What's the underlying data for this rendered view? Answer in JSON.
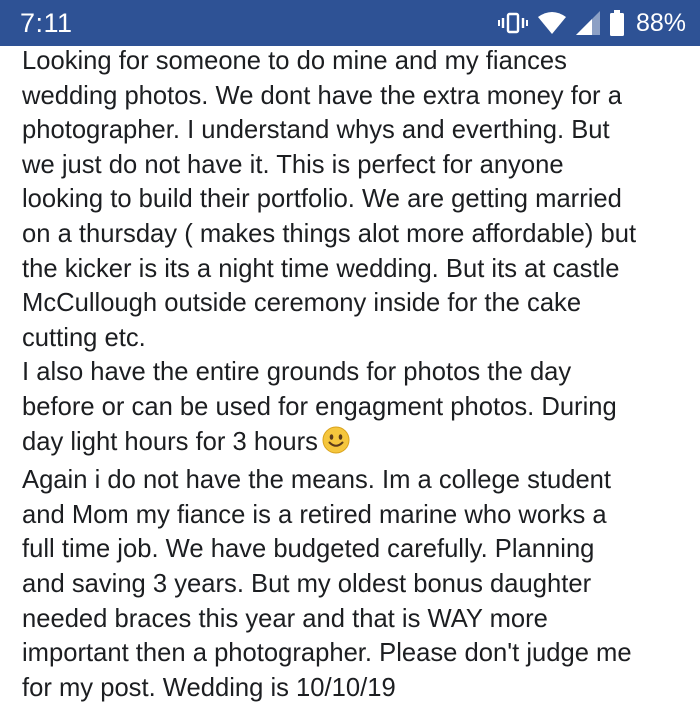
{
  "status_bar": {
    "time": "7:11",
    "battery_percent": "88%",
    "icons": [
      "vibrate-icon",
      "wifi-icon",
      "cell-signal-icon",
      "battery-icon"
    ],
    "background_color": "#2e5295"
  },
  "post": {
    "lines": [
      "Looking for someone to do mine and my fiances",
      "wedding photos. We dont have the extra money for a",
      "photographer. I understand whys and everthing. But",
      "we just do not have it. This is perfect for anyone",
      "looking to build their portfolio. We are getting married",
      "on a thursday ( makes things alot more affordable) but",
      "the kicker is its a night time wedding. But its at castle",
      "McCullough outside ceremony inside for the cake",
      "cutting etc.",
      "I also have the entire grounds for photos the day",
      "before or can be used for engagment photos. During",
      "day light hours for 3 hours",
      "Again i do not have the means. Im a college student",
      "and Mom my fiance is a retired marine who works a",
      "full time job. We have budgeted carefully. Planning",
      "and saving 3 years. But my oldest bonus daughter",
      "needed braces this year and that is WAY more",
      "important then a photographer. Please don't judge me",
      "for my post. Wedding is 10/10/19"
    ],
    "emoji_after_line": 11,
    "emoji": "smiley-face-emoji",
    "text_color": "#1c1e21"
  }
}
